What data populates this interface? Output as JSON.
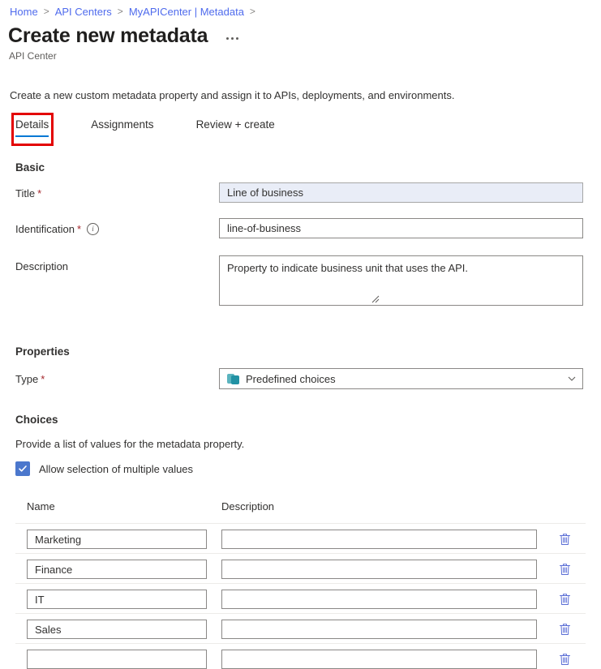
{
  "breadcrumb": {
    "items": [
      {
        "label": "Home"
      },
      {
        "label": "API Centers"
      },
      {
        "label": "MyAPICenter | Metadata"
      }
    ],
    "separator": ">"
  },
  "header": {
    "title": "Create new metadata",
    "subtitle": "API Center",
    "more_menu": "..."
  },
  "intro": "Create a new custom metadata property and assign it to APIs, deployments, and environments.",
  "tabs": [
    {
      "label": "Details",
      "active": true
    },
    {
      "label": "Assignments",
      "active": false
    },
    {
      "label": "Review + create",
      "active": false
    }
  ],
  "basic": {
    "section_title": "Basic",
    "title_label": "Title",
    "title_required": "*",
    "title_value": "Line of business",
    "identification_label": "Identification",
    "identification_required": "*",
    "identification_value": "line-of-business",
    "identification_info": "i",
    "description_label": "Description",
    "description_value": "Property to indicate business unit that uses the API."
  },
  "properties": {
    "section_title": "Properties",
    "type_label": "Type",
    "type_required": "*",
    "type_value": "Predefined choices",
    "type_icon": "predefined-choices-icon",
    "chevron_icon": "chevron-down-icon"
  },
  "choices": {
    "section_title": "Choices",
    "helper_text": "Provide a list of values for the metadata property.",
    "multi_checkbox_label": "Allow selection of multiple values",
    "multi_checkbox_checked": true,
    "columns": [
      "Name",
      "Description"
    ],
    "rows": [
      {
        "name": "Marketing",
        "description": ""
      },
      {
        "name": "Finance",
        "description": ""
      },
      {
        "name": "IT",
        "description": ""
      },
      {
        "name": "Sales",
        "description": ""
      },
      {
        "name": "",
        "description": ""
      }
    ],
    "delete_icon": "trash-icon"
  },
  "colors": {
    "link": "#4f6bed",
    "accent": "#0078d4",
    "annotation": "#e30000",
    "checkbox": "#4b77cd",
    "trash": "#5b6ed6",
    "required": "#a4262c",
    "type_icon": "#2292a4"
  }
}
